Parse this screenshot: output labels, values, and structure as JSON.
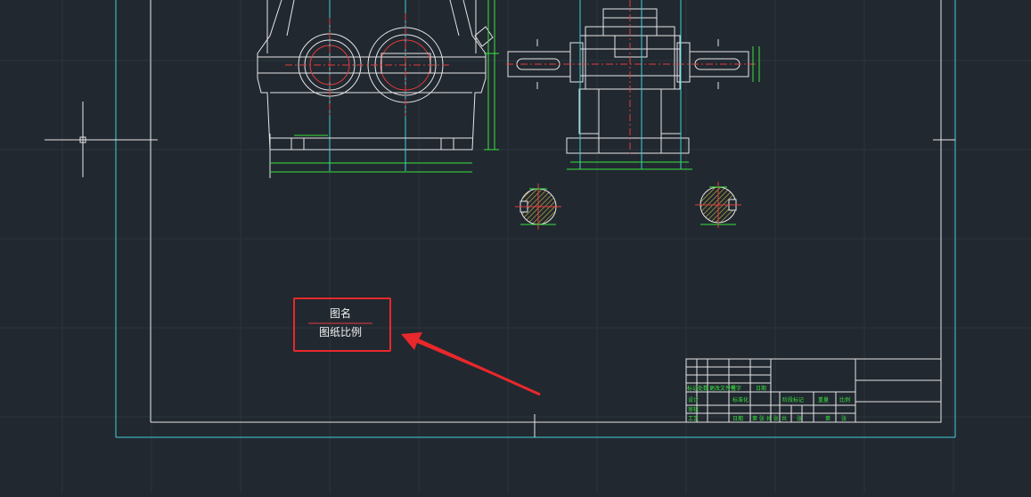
{
  "drawing": {
    "title_label": "图名",
    "scale_label": "图纸比例"
  },
  "title_block": {
    "row1": [
      "标记",
      "处数",
      "更改文件号",
      "签字",
      "日期"
    ],
    "row2": [
      "设计",
      "",
      "标准化",
      "",
      "阶段标记",
      "重量",
      "比例"
    ],
    "row3": [
      "审核",
      "",
      "",
      "",
      "",
      "",
      ""
    ],
    "row4": [
      "工艺",
      "",
      "日期",
      "第 张 共 张",
      "共",
      "张",
      "第",
      "张"
    ]
  },
  "colors": {
    "background": "#212830",
    "frame_cyan": "#40d0d8",
    "geometry_white": "#e6e6e6",
    "dimension_green": "#39e33d",
    "centerline_red": "#e23b3b",
    "hatch_yellow": "#d8c040",
    "highlight_red": "#e8282b"
  }
}
